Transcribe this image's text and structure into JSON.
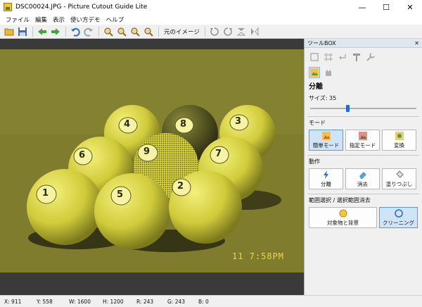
{
  "window": {
    "title": "DSC00024.JPG - Picture Cutout Guide Lite",
    "minimize": "—",
    "maximize": "☐",
    "close": "✕"
  },
  "menu": [
    "ファイル",
    "編集",
    "表示",
    "使い方デモ",
    "ヘルプ"
  ],
  "toolbar": {
    "restore_label": "元のイメージ"
  },
  "photo": {
    "timestamp": "11  7:58PM",
    "ball_numbers": [
      "4",
      "8",
      "3",
      "6",
      "9",
      "7",
      "1",
      "5",
      "2"
    ]
  },
  "toolbox": {
    "header": "ツールBOX",
    "close": "✕",
    "panel_title": "分離",
    "size_label": "サイズ: 35",
    "size_value": 35,
    "size_max": 100,
    "mode": {
      "label": "モード",
      "buttons": [
        "簡単モード",
        "指定モード",
        "変換"
      ],
      "active": 0
    },
    "action": {
      "label": "動作",
      "buttons": [
        "分離",
        "消去",
        "塗りつぶし"
      ]
    },
    "range": {
      "label": "範囲選択 / 選択範囲消去",
      "buttons": [
        "対象物と背景",
        "クリーニング"
      ],
      "active": 1
    }
  },
  "status": {
    "x": "X: 911",
    "y": "Y: 558",
    "w": "W: 1600",
    "h": "H: 1200",
    "r": "R: 243",
    "g": "G: 243",
    "b": "B: 0"
  },
  "colors": {
    "accent": "#1e6fd0",
    "photo_tint": "#d8d43a"
  }
}
